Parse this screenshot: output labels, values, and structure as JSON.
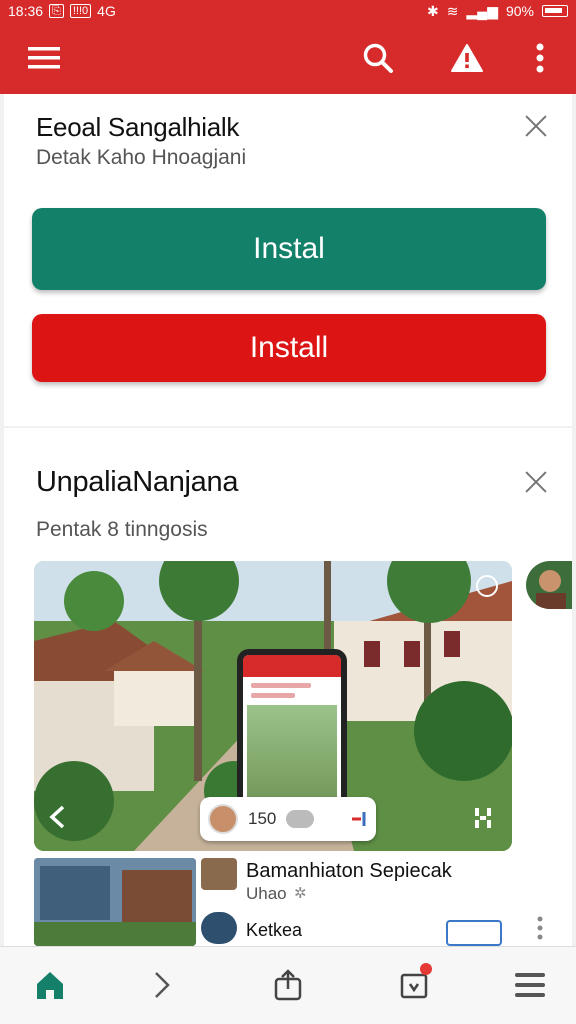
{
  "status_bar": {
    "time": "18:36",
    "left_box_1": "⎘",
    "left_box_2": "!!!0",
    "network": "4G",
    "battery_percent": "90%"
  },
  "app_bar": {
    "icons": [
      "menu-icon",
      "search-icon",
      "alert-icon",
      "more-vert-icon"
    ]
  },
  "card1": {
    "title": "Eeoal Sangalhialk",
    "subtitle": "Detak Kaho Hnoagjani",
    "primary_button": "Instal",
    "secondary_button": "Install"
  },
  "card2": {
    "title": "UnpaliaNanjana",
    "subtitle": "Pentak 8 tinngosis",
    "media": {
      "pill_number": "150"
    },
    "list": [
      {
        "title": "Bamanhiaton Sepiecak",
        "sub": "Uhao"
      },
      {
        "title": "Ketkea",
        "sub": ""
      }
    ]
  },
  "colors": {
    "brand_red": "#d72b2b",
    "install_teal": "#13806a",
    "install_red": "#dd1414",
    "home_teal": "#14806a"
  },
  "bottom_nav": {
    "icons": [
      "home-icon",
      "chevron-right-icon",
      "share-icon",
      "inbox-icon",
      "menu-lines-icon"
    ]
  }
}
